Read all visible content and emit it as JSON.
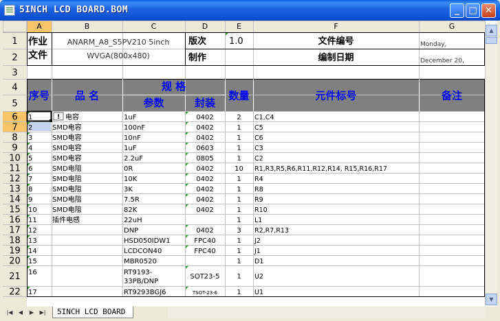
{
  "window": {
    "title": "5INCH LCD BOARD.BOM",
    "minimize": "_",
    "maximize": "□",
    "close": "✕"
  },
  "columns": [
    "A",
    "B",
    "C",
    "D",
    "E",
    "F",
    "G"
  ],
  "rows": [
    "1",
    "2",
    "3",
    "4",
    "5",
    "6",
    "7",
    "8",
    "9",
    "10",
    "11",
    "12",
    "13",
    "14",
    "15",
    "16",
    "17",
    "18",
    "19",
    "20",
    "21",
    "22"
  ],
  "header": {
    "doc_label": "作业文件",
    "project": "ANARM_A8_S5PV210 5inch WVGA(800x480)",
    "version_label": "版次",
    "version": "1.0",
    "file_no_label": "文件编号",
    "made_label": "制作",
    "date_label": "编制日期",
    "date_value": "Monday, December 20,",
    "seq": "序号",
    "name": "品 名",
    "spec": "规 格",
    "param": "参数",
    "package": "封装",
    "qty": "数量",
    "refs": "元件标号",
    "notes": "备注"
  },
  "items": [
    {
      "row": "6",
      "no": "1",
      "name": "电容",
      "value": "1uF",
      "pkg": "0402",
      "qty": "2",
      "ref": "C1,C4"
    },
    {
      "row": "7",
      "no": "2",
      "name": "SMD电容",
      "value": "100nF",
      "pkg": "0402",
      "qty": "1",
      "ref": "C5"
    },
    {
      "row": "8",
      "no": "3",
      "name": "SMD电容",
      "value": "10nF",
      "pkg": "0402",
      "qty": "1",
      "ref": "C6"
    },
    {
      "row": "9",
      "no": "4",
      "name": "SMD电容",
      "value": "1uF",
      "pkg": "0603",
      "qty": "1",
      "ref": "C3"
    },
    {
      "row": "10",
      "no": "5",
      "name": "SMD电容",
      "value": "2.2uF",
      "pkg": "0805",
      "qty": "1",
      "ref": "C2"
    },
    {
      "row": "11",
      "no": "6",
      "name": "SMD电阻",
      "value": "0R",
      "pkg": "0402",
      "qty": "10",
      "ref": "R1,R3,R5,R6,R11,R12,R14, R15,R16,R17"
    },
    {
      "row": "12",
      "no": "7",
      "name": "SMD电阻",
      "value": "10K",
      "pkg": "0402",
      "qty": "1",
      "ref": "R4"
    },
    {
      "row": "13",
      "no": "8",
      "name": "SMD电阻",
      "value": "3K",
      "pkg": "0402",
      "qty": "1",
      "ref": "R8"
    },
    {
      "row": "14",
      "no": "9",
      "name": "SMD电阻",
      "value": "7.5R",
      "pkg": "0402",
      "qty": "1",
      "ref": "R9"
    },
    {
      "row": "15",
      "no": "10",
      "name": "SMD电阻",
      "value": "82K",
      "pkg": "0402",
      "qty": "1",
      "ref": "R10"
    },
    {
      "row": "16",
      "no": "11",
      "name": "插件电感",
      "value": "22uH",
      "pkg": "",
      "qty": "1",
      "ref": "L1"
    },
    {
      "row": "17",
      "no": "12",
      "name": "",
      "value": "DNP",
      "pkg": "0402",
      "qty": "3",
      "ref": "R2,R7,R13"
    },
    {
      "row": "18",
      "no": "13",
      "name": "",
      "value": "HSD050IDW1",
      "pkg": "FPC40",
      "qty": "1",
      "ref": "J2"
    },
    {
      "row": "19",
      "no": "14",
      "name": "",
      "value": "LCDCON40",
      "pkg": "FPC40",
      "qty": "1",
      "ref": "J1"
    },
    {
      "row": "20",
      "no": "15",
      "name": "",
      "value": "MBR0520",
      "pkg": "",
      "qty": "1",
      "ref": "D1"
    },
    {
      "row": "21",
      "no": "16",
      "name": "",
      "value": "RT9193-33PB/DNP",
      "pkg": "SOT23-5",
      "qty": "1",
      "ref": "U2"
    },
    {
      "row": "22",
      "no": "17",
      "name": "",
      "value": "RT9293BGJ6",
      "pkg": "TSOT-23-6",
      "qty": "1",
      "ref": "U1"
    }
  ],
  "sheet_tab": "5INCH LCD BOARD",
  "colors": {
    "header_fill": "#808080",
    "header_text": "#0000ff",
    "grid": "#c0c0c0",
    "selection_header": "#f8c46a"
  }
}
